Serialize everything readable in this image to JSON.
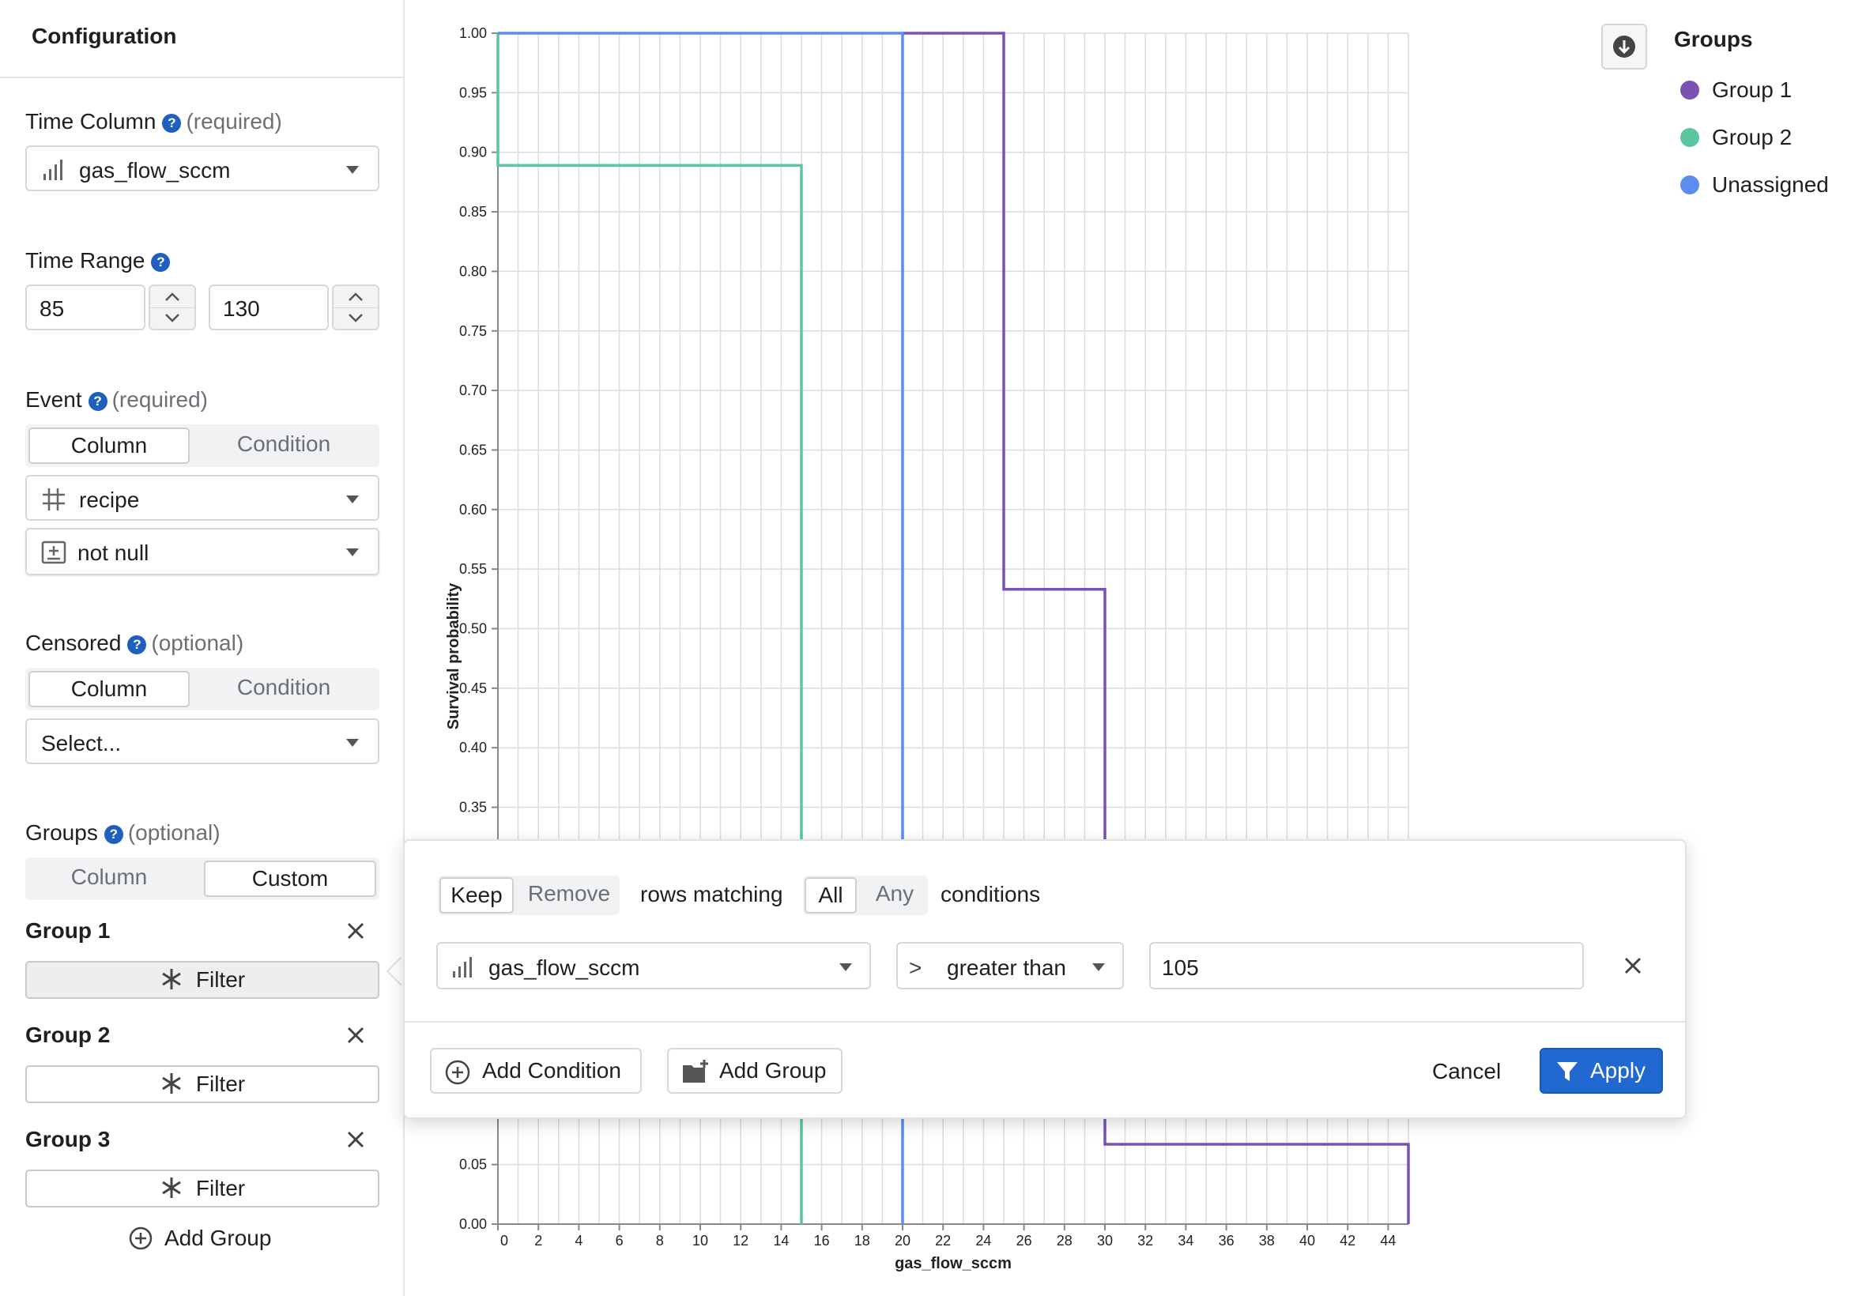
{
  "sidebar": {
    "title": "Configuration",
    "time_column": {
      "label": "Time Column",
      "hint": "(required)",
      "value": "gas_flow_sccm",
      "icon": "bar-chart-icon"
    },
    "time_range": {
      "label": "Time Range",
      "min": "85",
      "max": "130"
    },
    "event": {
      "label": "Event",
      "hint": "(required)",
      "modes": [
        "Column",
        "Condition"
      ],
      "active_mode": "Column",
      "column": "recipe",
      "column_icon": "grid-icon",
      "operator": "not null",
      "operator_icon": "plus-square-icon"
    },
    "censored": {
      "label": "Censored",
      "hint": "(optional)",
      "modes": [
        "Column",
        "Condition"
      ],
      "active_mode": "Column",
      "placeholder": "Select..."
    },
    "groups": {
      "label": "Groups",
      "hint": "(optional)",
      "modes": [
        "Column",
        "Custom"
      ],
      "active_mode": "Custom",
      "items": [
        {
          "name": "Group 1",
          "button": "Filter"
        },
        {
          "name": "Group 2",
          "button": "Filter"
        },
        {
          "name": "Group 3",
          "button": "Filter"
        }
      ],
      "add_label": "Add Group"
    }
  },
  "legend": {
    "title": "Groups",
    "items": [
      {
        "label": "Group 1",
        "color": "#7952b3"
      },
      {
        "label": "Group 2",
        "color": "#5cc79e"
      },
      {
        "label": "Unassigned",
        "color": "#5b8def"
      }
    ]
  },
  "filter_popover": {
    "mode_options": [
      "Keep",
      "Remove"
    ],
    "mode_selected": "Keep",
    "rows_text": "rows matching",
    "match_options": [
      "All",
      "Any"
    ],
    "match_selected": "All",
    "conditions_text": "conditions",
    "condition": {
      "column": "gas_flow_sccm",
      "operator_symbol": ">",
      "operator": "greater than",
      "value": "105"
    },
    "add_condition": "Add Condition",
    "add_group": "Add Group",
    "cancel": "Cancel",
    "apply": "Apply"
  },
  "chart_data": {
    "type": "line",
    "xlabel": "gas_flow_sccm",
    "ylabel": "Survival probability",
    "xlim": [
      0,
      45
    ],
    "ylim": [
      0,
      1
    ],
    "x_ticks": [
      0,
      2,
      4,
      6,
      8,
      10,
      12,
      14,
      16,
      18,
      20,
      22,
      24,
      26,
      28,
      30,
      32,
      34,
      36,
      38,
      40,
      42,
      44
    ],
    "y_ticks": [
      "1.00",
      "0.95",
      "0.90",
      "0.85",
      "0.80",
      "0.75",
      "0.70",
      "0.65",
      "0.60",
      "0.55",
      "0.50",
      "0.45",
      "0.40",
      "0.35",
      "0.05",
      "0.00"
    ],
    "y_tick_values": [
      1.0,
      0.95,
      0.9,
      0.85,
      0.8,
      0.75,
      0.7,
      0.65,
      0.6,
      0.55,
      0.5,
      0.45,
      0.4,
      0.35,
      0.05,
      0.0
    ],
    "grid": true,
    "step": true,
    "series": [
      {
        "name": "Group 1",
        "color": "#7952b3",
        "x": [
          20,
          25,
          30,
          45,
          45
        ],
        "y": [
          1.0,
          0.533,
          0.067,
          0.067,
          0.0
        ]
      },
      {
        "name": "Group 2",
        "color": "#5cc79e",
        "x": [
          0,
          0,
          15,
          15
        ],
        "y": [
          1.0,
          0.889,
          0.0,
          0.0
        ]
      },
      {
        "name": "Unassigned",
        "color": "#5b8def",
        "x": [
          0,
          20,
          20
        ],
        "y": [
          1.0,
          0.0,
          0.0
        ]
      }
    ]
  }
}
